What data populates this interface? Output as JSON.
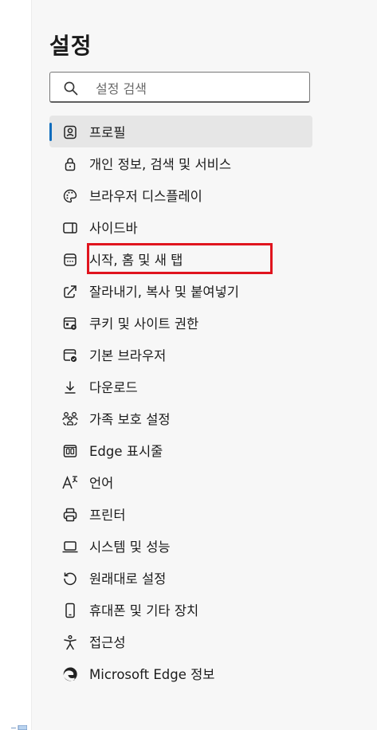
{
  "page": {
    "title": "설정"
  },
  "search": {
    "placeholder": "설정 검색"
  },
  "nav": {
    "items": [
      {
        "label": "프로필",
        "icon": "profile-icon",
        "active": true
      },
      {
        "label": "개인 정보, 검색 및 서비스",
        "icon": "lock-icon"
      },
      {
        "label": "브라우저 디스플레이",
        "icon": "palette-icon"
      },
      {
        "label": "사이드바",
        "icon": "sidebar-icon"
      },
      {
        "label": "시작, 홈 및 새 탭",
        "icon": "home-tab-icon",
        "highlighted": true
      },
      {
        "label": "잘라내기, 복사 및 붙여넣기",
        "icon": "share-icon"
      },
      {
        "label": "쿠키 및 사이트 권한",
        "icon": "site-permissions-icon"
      },
      {
        "label": "기본 브라우저",
        "icon": "default-browser-icon"
      },
      {
        "label": "다운로드",
        "icon": "download-icon"
      },
      {
        "label": "가족 보호 설정",
        "icon": "family-icon"
      },
      {
        "label": "Edge 표시줄",
        "icon": "edge-bar-icon"
      },
      {
        "label": "언어",
        "icon": "language-icon"
      },
      {
        "label": "프린터",
        "icon": "printer-icon"
      },
      {
        "label": "시스템 및 성능",
        "icon": "laptop-icon"
      },
      {
        "label": "원래대로 설정",
        "icon": "reset-icon"
      },
      {
        "label": "휴대폰 및 기타 장치",
        "icon": "phone-icon"
      },
      {
        "label": "접근성",
        "icon": "accessibility-icon"
      },
      {
        "label": "Microsoft Edge 정보",
        "icon": "edge-logo-icon"
      }
    ]
  },
  "colors": {
    "accent": "#0f6cbd",
    "highlight": "#e0141e",
    "panel_bg": "#f7f7f7"
  }
}
